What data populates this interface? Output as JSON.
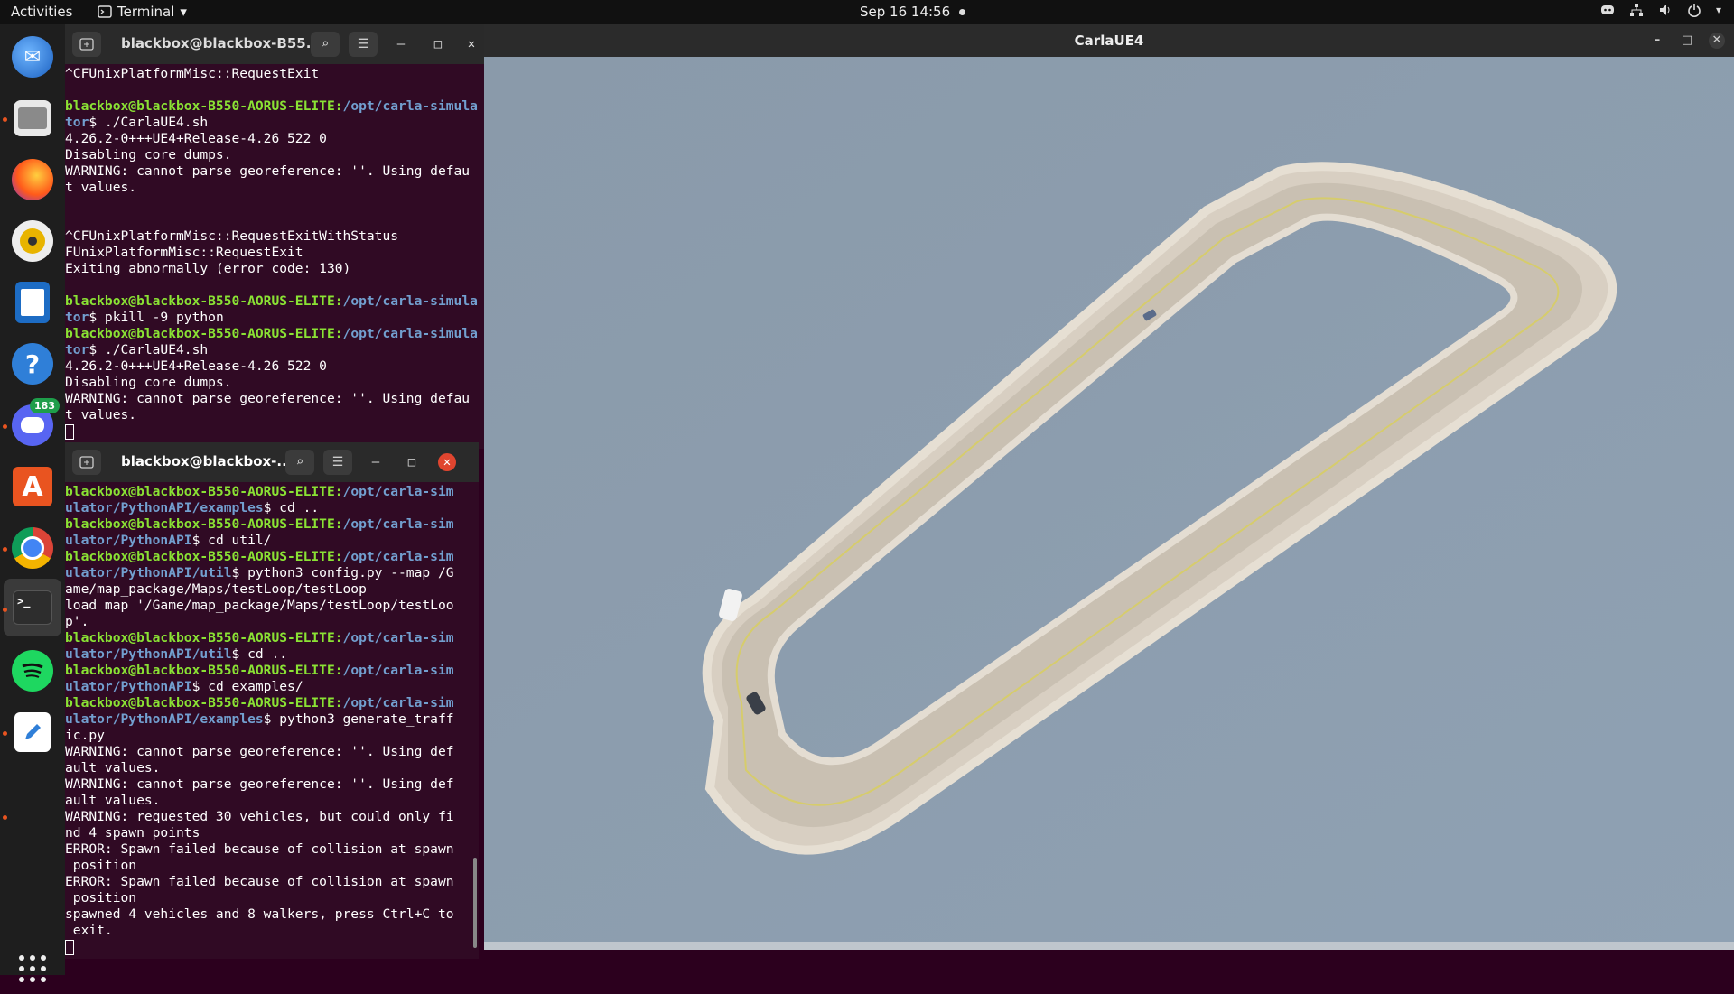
{
  "topbar": {
    "activities": "Activities",
    "app_name": "Terminal",
    "clock": "Sep 16  14:56"
  },
  "dock": {
    "discord_badge": "183"
  },
  "terminal1": {
    "title": "blackbox@blackbox-B55...",
    "lines": [
      {
        "t": "^CFUnixPlatformMisc::RequestExit"
      },
      {
        "t": ""
      },
      {
        "u": "blackbox@blackbox-B550-AORUS-ELITE",
        "p": "/opt/carla-simula"
      },
      {
        "p": "tor",
        "t": "$ ./CarlaUE4.sh"
      },
      {
        "t": "4.26.2-0+++UE4+Release-4.26 522 0"
      },
      {
        "t": "Disabling core dumps."
      },
      {
        "t": "WARNING: cannot parse georeference: ''. Using defau"
      },
      {
        "t": "t values."
      },
      {
        "t": ""
      },
      {
        "t": ""
      },
      {
        "t": "^CFUnixPlatformMisc::RequestExitWithStatus"
      },
      {
        "t": "FUnixPlatformMisc::RequestExit"
      },
      {
        "t": "Exiting abnormally (error code: 130)"
      },
      {
        "t": ""
      },
      {
        "u": "blackbox@blackbox-B550-AORUS-ELITE",
        "p": "/opt/carla-simula"
      },
      {
        "p": "tor",
        "t": "$ pkill -9 python"
      },
      {
        "u": "blackbox@blackbox-B550-AORUS-ELITE",
        "p": "/opt/carla-simula"
      },
      {
        "p": "tor",
        "t": "$ ./CarlaUE4.sh"
      },
      {
        "t": "4.26.2-0+++UE4+Release-4.26 522 0"
      },
      {
        "t": "Disabling core dumps."
      },
      {
        "t": "WARNING: cannot parse georeference: ''. Using defau"
      },
      {
        "t": "t values."
      }
    ]
  },
  "terminal2": {
    "title": "blackbox@blackbox-...",
    "lines": [
      {
        "u": "blackbox@blackbox-B550-AORUS-ELITE",
        "p": "/opt/carla-sim"
      },
      {
        "p": "ulator/PythonAPI/examples",
        "t": "$ cd .."
      },
      {
        "u": "blackbox@blackbox-B550-AORUS-ELITE",
        "p": "/opt/carla-sim"
      },
      {
        "p": "ulator/PythonAPI",
        "t": "$ cd util/"
      },
      {
        "u": "blackbox@blackbox-B550-AORUS-ELITE",
        "p": "/opt/carla-sim"
      },
      {
        "p": "ulator/PythonAPI/util",
        "t": "$ python3 config.py --map /G"
      },
      {
        "t": "ame/map_package/Maps/testLoop/testLoop"
      },
      {
        "t": "load map '/Game/map_package/Maps/testLoop/testLoo"
      },
      {
        "t": "p'."
      },
      {
        "u": "blackbox@blackbox-B550-AORUS-ELITE",
        "p": "/opt/carla-sim"
      },
      {
        "p": "ulator/PythonAPI/util",
        "t": "$ cd .."
      },
      {
        "u": "blackbox@blackbox-B550-AORUS-ELITE",
        "p": "/opt/carla-sim"
      },
      {
        "p": "ulator/PythonAPI",
        "t": "$ cd examples/"
      },
      {
        "u": "blackbox@blackbox-B550-AORUS-ELITE",
        "p": "/opt/carla-sim"
      },
      {
        "p": "ulator/PythonAPI/examples",
        "t": "$ python3 generate_traff"
      },
      {
        "t": "ic.py"
      },
      {
        "t": "WARNING: cannot parse georeference: ''. Using def"
      },
      {
        "t": "ault values."
      },
      {
        "t": "WARNING: cannot parse georeference: ''. Using def"
      },
      {
        "t": "ault values."
      },
      {
        "t": "WARNING: requested 30 vehicles, but could only fi"
      },
      {
        "t": "nd 4 spawn points"
      },
      {
        "t": "ERROR: Spawn failed because of collision at spawn"
      },
      {
        "t": " position"
      },
      {
        "t": "ERROR: Spawn failed because of collision at spawn"
      },
      {
        "t": " position"
      },
      {
        "t": "spawned 4 vehicles and 8 walkers, press Ctrl+C to"
      },
      {
        "t": " exit."
      }
    ]
  },
  "carla": {
    "title": "CarlaUE4"
  }
}
